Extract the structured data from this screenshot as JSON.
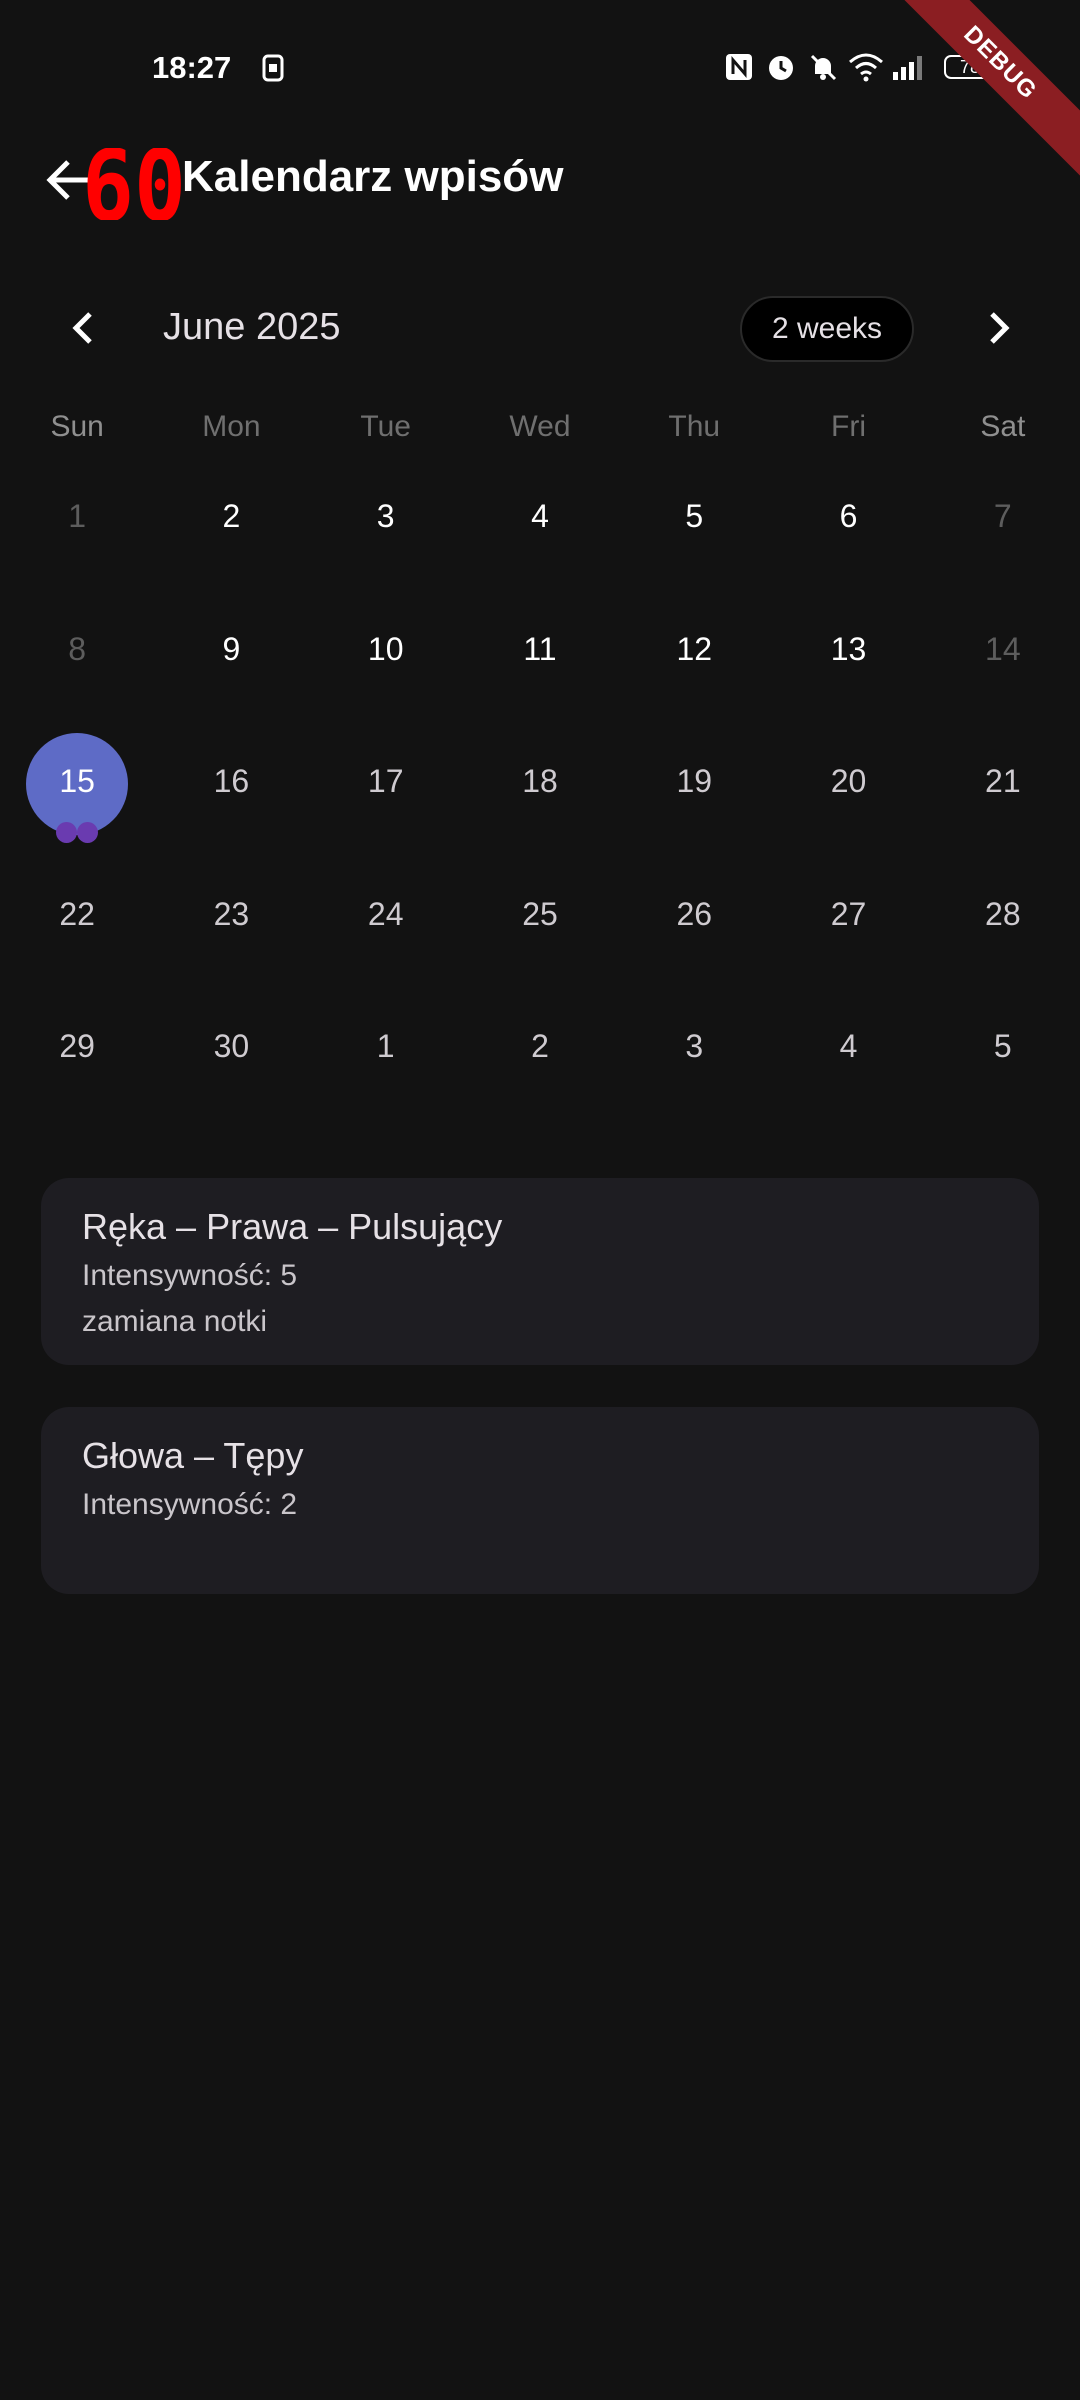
{
  "status_bar": {
    "time": "18:27",
    "battery": "78",
    "icons": [
      "sim-icon",
      "nfc-icon",
      "alarm-icon",
      "bell-off-icon",
      "wifi-icon",
      "signal-icon",
      "battery-icon"
    ]
  },
  "debug_banner": "DEBUG",
  "app_bar": {
    "title": "Kalendarz wpisów",
    "fps_overlay": "60",
    "back_icon": "arrow-left-icon"
  },
  "calendar": {
    "month_title": "June 2025",
    "format_button": "2 weeks",
    "weekdays": [
      "Sun",
      "Mon",
      "Tue",
      "Wed",
      "Thu",
      "Fri",
      "Sat"
    ],
    "rows": [
      [
        "1",
        "2",
        "3",
        "4",
        "5",
        "6",
        "7"
      ],
      [
        "8",
        "9",
        "10",
        "11",
        "12",
        "13",
        "14"
      ],
      [
        "15",
        "16",
        "17",
        "18",
        "19",
        "20",
        "21"
      ],
      [
        "22",
        "23",
        "24",
        "25",
        "26",
        "27",
        "28"
      ],
      [
        "29",
        "30",
        "1",
        "2",
        "3",
        "4",
        "5"
      ]
    ],
    "selected_day": "15",
    "event_markers_on_selected": 2
  },
  "entries": [
    {
      "title": "Ręka – Prawa – Pulsujący",
      "intensity": "Intensywność: 5",
      "note": "zamiana notki"
    },
    {
      "title": "Głowa – Tępy",
      "intensity": "Intensywność: 2"
    }
  ],
  "colors": {
    "background": "#121212",
    "selected_day": "#5E6BC6",
    "marker": "#6A3BB0",
    "card": "#1E1D22",
    "fps_overlay": "#FF0000",
    "debug_ribbon": "#8B1E22"
  }
}
